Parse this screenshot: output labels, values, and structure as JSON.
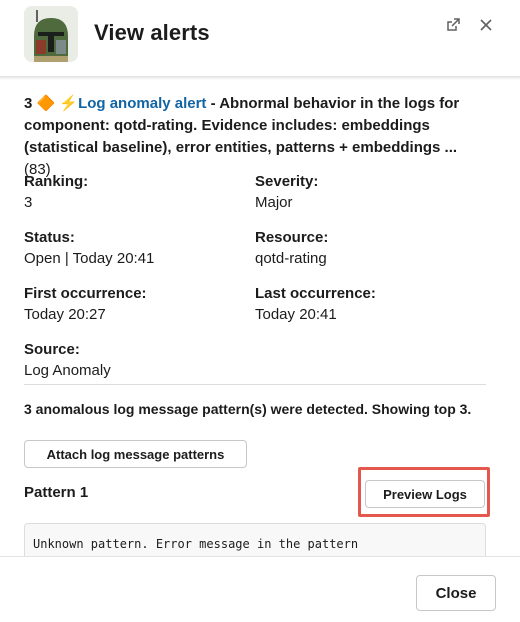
{
  "header": {
    "title": "View alerts",
    "open_external_icon": "open-external-icon",
    "close_icon": "close-icon"
  },
  "alert": {
    "count": "3",
    "diamond_emoji": "🔶",
    "bolt_emoji": "⚡",
    "link_text": "Log anomaly alert",
    "description": " - Abnormal behavior in the logs for component: qotd-rating. Evidence includes: embeddings (statistical baseline), error entities, patterns + embeddings ...",
    "extra_count": "(83)"
  },
  "fields": {
    "ranking_label": "Ranking:",
    "ranking_value": "3",
    "severity_label": "Severity:",
    "severity_value": "Major",
    "status_label": "Status:",
    "status_value": "Open | Today 20:41",
    "resource_label": "Resource:",
    "resource_value": "qotd-rating",
    "first_occurrence_label": "First occurrence:",
    "first_occurrence_value": "Today 20:27",
    "last_occurrence_label": "Last occurrence:",
    "last_occurrence_value": "Today 20:41",
    "source_label": "Source:",
    "source_value": "Log Anomaly"
  },
  "patterns": {
    "notice": "3 anomalous log message pattern(s) were detected. Showing top 3.",
    "attach_button": "Attach log message patterns",
    "pattern_title": "Pattern 1",
    "preview_button": "Preview Logs",
    "pattern_text": "Unknown pattern. Error message in the pattern"
  },
  "footer": {
    "close_button": "Close"
  },
  "colors": {
    "link": "#1264a3",
    "highlight": "#e3574c"
  }
}
